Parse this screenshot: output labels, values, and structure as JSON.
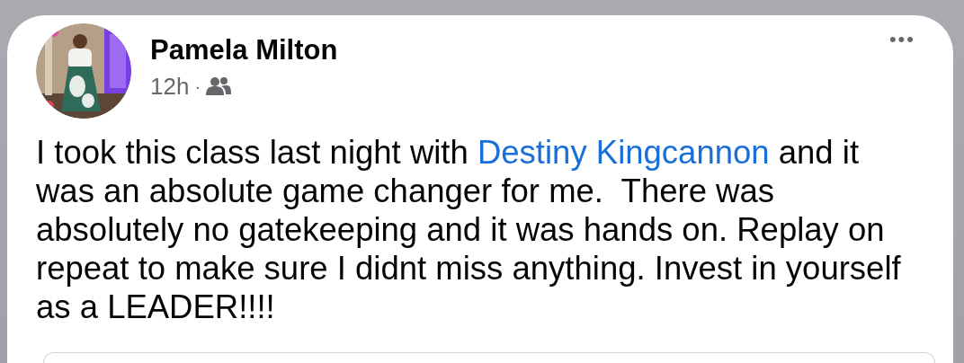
{
  "post": {
    "author": "Pamela Milton",
    "time": "12h",
    "separator": "·",
    "shared_with_group": true,
    "menu": "•••",
    "body": [
      {
        "kind": "text",
        "text": "I took this class last night with "
      },
      {
        "kind": "mention",
        "text": "Destiny Kingcannon"
      },
      {
        "kind": "text",
        "text": " and it was an absolute game changer for me.  There was absolutely no gatekeeping and it was hands on. Replay on repeat to make sure I didnt miss anything. Invest in yourself as a LEADER!!!!"
      }
    ]
  }
}
